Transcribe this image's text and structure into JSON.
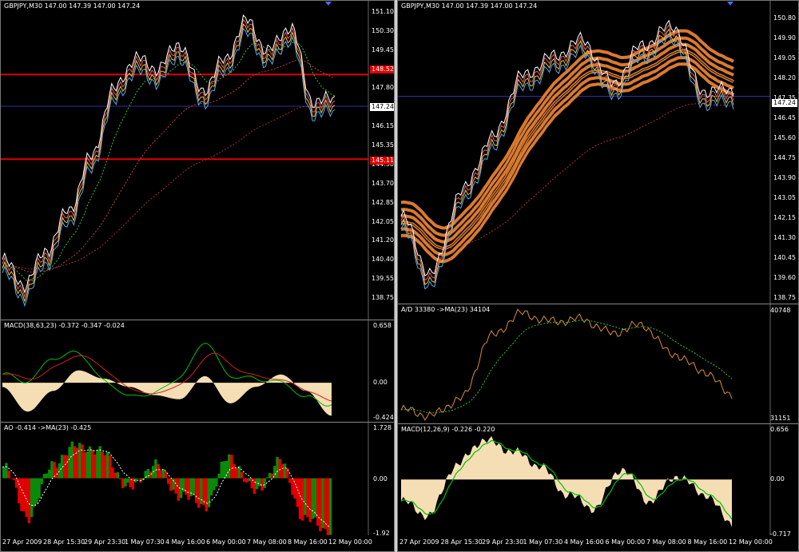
{
  "left_window": {
    "price_title": "GBPJPY,M30  147.00 147.39 147.00 147.24",
    "price_ticks": [
      "151.10",
      "150.30",
      "149.45",
      "148.65",
      "147.80",
      "147.00",
      "146.15",
      "145.35",
      "144.50",
      "143.70",
      "142.85",
      "142.05",
      "141.20",
      "140.40",
      "139.55",
      "138.75"
    ],
    "current_price": "147.24",
    "hline_upper": "148.52",
    "hline_lower": "145.11",
    "macd_title": "MACD(38,63,23) -0.372 -0.347 -0.024",
    "macd_ticks": [
      "0.658",
      "0.00",
      "-0.424"
    ],
    "ao_title": "AO -0.414  ->MA(23) -0.425",
    "ao_ticks": [
      "1.728",
      "0.00",
      "-1.92"
    ],
    "x_labels": [
      "27 Apr 2009",
      "28 Apr 15:30",
      "29 Apr 23:30",
      "1 May 07:30",
      "4 May 16:00",
      "6 May 00:00",
      "7 May 08:00",
      "8 May 16:00",
      "12 May 00:00"
    ]
  },
  "right_window": {
    "price_title": "GBPJPY,M30  147.00 147.39 147.00 147.24",
    "price_ticks": [
      "150.80",
      "149.90",
      "149.05",
      "148.20",
      "147.35",
      "146.45",
      "145.60",
      "144.75",
      "143.90",
      "143.05",
      "142.15",
      "141.30",
      "140.45",
      "139.60",
      "138.75"
    ],
    "current_price": "147.24",
    "ad_title": "A/D 33380  ->MA(23) 34104",
    "ad_ticks": [
      "40748",
      "31151"
    ],
    "macd_title": "MACD(12,26,9) -0.226 -0.220",
    "macd_ticks": [
      "0.656",
      "0.00",
      "-0.717"
    ],
    "x_labels": [
      "27 Apr 2009",
      "28 Apr 15:30",
      "29 Apr 23:30",
      "1 May 07:30",
      "4 May 16:00",
      "6 May 00:00",
      "7 May 08:00",
      "8 May 16:00",
      "12 May 00:00"
    ]
  },
  "colors": {
    "background": "#000000",
    "price_bars": "#5aa8e6",
    "hline": "#e00000",
    "ribbon": "#d97a30",
    "macd_hist": "#f5deb3",
    "ao_up": "#0a8a0a",
    "ao_down": "#e00000",
    "ad_line": "#d98c3a"
  },
  "chart_data": [
    {
      "type": "line",
      "name": "left-price",
      "series": [
        {
          "values": [
            140.8,
            139.8,
            141.2,
            142.8,
            144.9,
            147.6,
            148.9,
            148.5,
            149.5,
            147.6,
            148.8,
            150.4,
            149.2,
            150.2,
            147.2,
            147.24
          ]
        }
      ],
      "ylim": [
        138.75,
        151.1
      ],
      "hlines": [
        148.52,
        145.11
      ]
    },
    {
      "type": "bar",
      "name": "left-macd",
      "values": [
        -0.05,
        -0.35,
        -0.1,
        0.15,
        0.05,
        -0.05,
        -0.15,
        -0.2,
        0.08,
        -0.25,
        -0.05,
        0.1,
        -0.1,
        -0.4
      ],
      "ylim": [
        -0.424,
        0.658
      ]
    },
    {
      "type": "bar",
      "name": "left-ao",
      "values": [
        0.4,
        -1.4,
        0.6,
        1.2,
        0.9,
        -0.4,
        0.5,
        -0.6,
        -1.0,
        0.8,
        -0.5,
        0.6,
        -1.5,
        -1.9
      ],
      "ylim": [
        -1.92,
        1.728
      ]
    },
    {
      "type": "line",
      "name": "right-price",
      "series": [
        {
          "values": [
            142.0,
            139.6,
            143.0,
            145.2,
            147.8,
            148.6,
            149.3,
            147.5,
            149.1,
            149.9,
            147.2,
            147.24
          ]
        }
      ],
      "ylim": [
        138.75,
        150.8
      ]
    },
    {
      "type": "line",
      "name": "right-ad",
      "series": [
        {
          "values": [
            32000,
            31500,
            33000,
            38500,
            40500,
            39800,
            40000,
            38800,
            39500,
            37000,
            35500,
            33380
          ]
        }
      ],
      "ylim": [
        31151,
        40748
      ]
    },
    {
      "type": "bar",
      "name": "right-macd",
      "values": [
        -0.3,
        -0.5,
        0.2,
        0.55,
        0.4,
        0.2,
        -0.2,
        -0.4,
        0.15,
        -0.3,
        0.05,
        -0.2,
        -0.6
      ],
      "ylim": [
        -0.717,
        0.656
      ]
    }
  ]
}
